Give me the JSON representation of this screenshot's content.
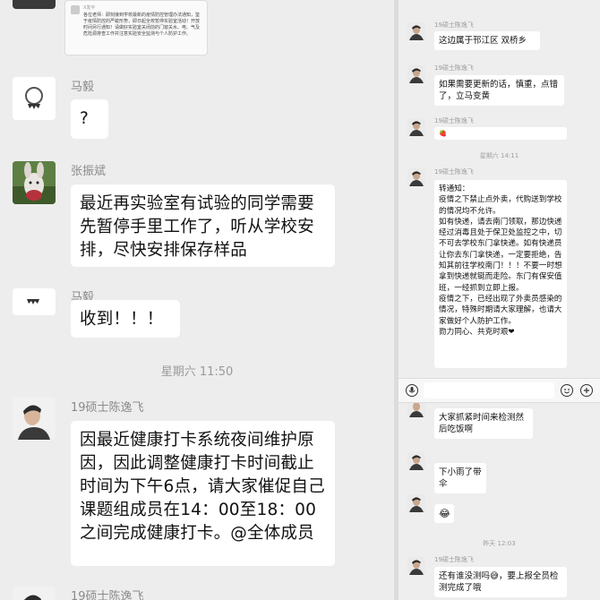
{
  "left_chat": {
    "top_card": {
      "name": "X发平",
      "text": "各位老师：即刻接到学校最新的疫情防控管理办法通知，鉴于疫情防控的严峻形势，即日起全校暂停实验室活动！开放时间另行通知！请做好实验室关闭前的门窗关水、电、气及危险源排查工作并注意实验安全监测与个人防护工作。"
    },
    "messages": [
      {
        "sender": "马毅",
        "text": "?"
      },
      {
        "sender": "张振斌",
        "text": "最近再实验室有试验的同学需要先暂停手里工作了，听从学校安排，尽快安排保存样品"
      },
      {
        "sender": "马毅",
        "text": "收到！！！"
      },
      {
        "sender": "19硕士陈逸飞",
        "text": "因最近健康打卡系统夜间维护原因，因此调整健康打卡时间截止时间为下午6点，请大家催促自己课题组成员在14：00至18：00之间完成健康打卡。@全体成员"
      },
      {
        "sender": "19硕士陈逸飞",
        "text": ""
      }
    ],
    "timestamp": "星期六 11:50"
  },
  "right_chat": {
    "messages_top": [
      {
        "sender": "19硕士陈逸飞",
        "text": "这边属于邗江区 双桥乡"
      },
      {
        "sender": "19硕士陈逸飞",
        "text": "如果需要更新的话，慎重，点错了，立马变黄"
      },
      {
        "sender": "19硕士陈逸飞",
        "text": "🍓"
      }
    ],
    "time_1": "星期六 14:11",
    "notice": {
      "sender": "19硕士陈逸飞",
      "text": "转通知：\n疫情之下禁止点外卖，代购送到学校的情况均不允许。\n如有快递，请去南门领取，那边快递经过消毒且处于保卫处监控之中，切不可去学校东门拿快递。如有快递员让你去东门拿快递，一定要拒绝，告知其前往学校南门！！！不要一时想拿到快递就铤而走险。东门有保安值班，一经抓到立即上报。\n疫情之下，已经出现了外卖员感染的情况，特殊时期请大家理解，也请大家做好个人防护工作。\n勠力同心、共克时艰❤"
    },
    "messages_bottom": [
      {
        "sender": "",
        "text": "大家抓紧时间来检测然后吃饭啊"
      },
      {
        "sender": "",
        "text": "下小雨了带伞"
      },
      {
        "sender": "",
        "text": "😂"
      }
    ],
    "time_2": "昨天 12:03",
    "last": {
      "sender": "19硕士陈逸飞",
      "text": "还有谁没测吗😅，要上报全员检测完成了哦"
    }
  },
  "colors": {
    "bg": "#ededed",
    "bubble": "#ffffff",
    "name": "#8a8a8a"
  }
}
